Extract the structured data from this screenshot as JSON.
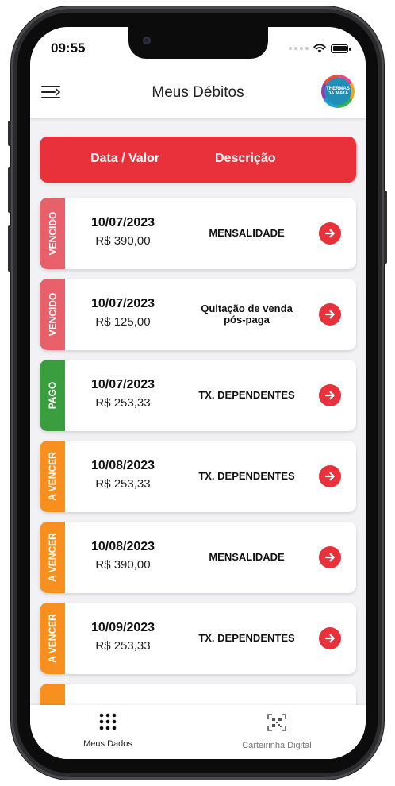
{
  "status_bar": {
    "time": "09:55"
  },
  "app_bar": {
    "title": "Meus Débitos",
    "logo": {
      "line1": "THERMAS",
      "line2": "DA MATA"
    }
  },
  "list_header": {
    "col_date_value": "Data / Valor",
    "col_description": "Descrição"
  },
  "colors": {
    "accent": "#e8313a",
    "vencido": "#e8606a",
    "pago": "#3a9d3e",
    "a_vencer": "#f7901e"
  },
  "debits": [
    {
      "status": "VENCIDO",
      "date": "10/07/2023",
      "value": "R$ 390,00",
      "description": "MENSALIDADE"
    },
    {
      "status": "VENCIDO",
      "date": "10/07/2023",
      "value": "R$ 125,00",
      "description": "Quitação de venda pós-paga"
    },
    {
      "status": "PAGO",
      "date": "10/07/2023",
      "value": "R$ 253,33",
      "description": "TX. DEPENDENTES"
    },
    {
      "status": "A VENCER",
      "date": "10/08/2023",
      "value": "R$ 253,33",
      "description": "TX. DEPENDENTES"
    },
    {
      "status": "A VENCER",
      "date": "10/08/2023",
      "value": "R$ 390,00",
      "description": "MENSALIDADE"
    },
    {
      "status": "A VENCER",
      "date": "10/09/2023",
      "value": "R$ 253,33",
      "description": "TX. DEPENDENTES"
    }
  ],
  "bottom_nav": {
    "items": [
      {
        "label": "Meus Dados",
        "icon": "grid-icon"
      },
      {
        "label": "Carteirinha Digital",
        "icon": "qr-code-icon"
      }
    ]
  }
}
